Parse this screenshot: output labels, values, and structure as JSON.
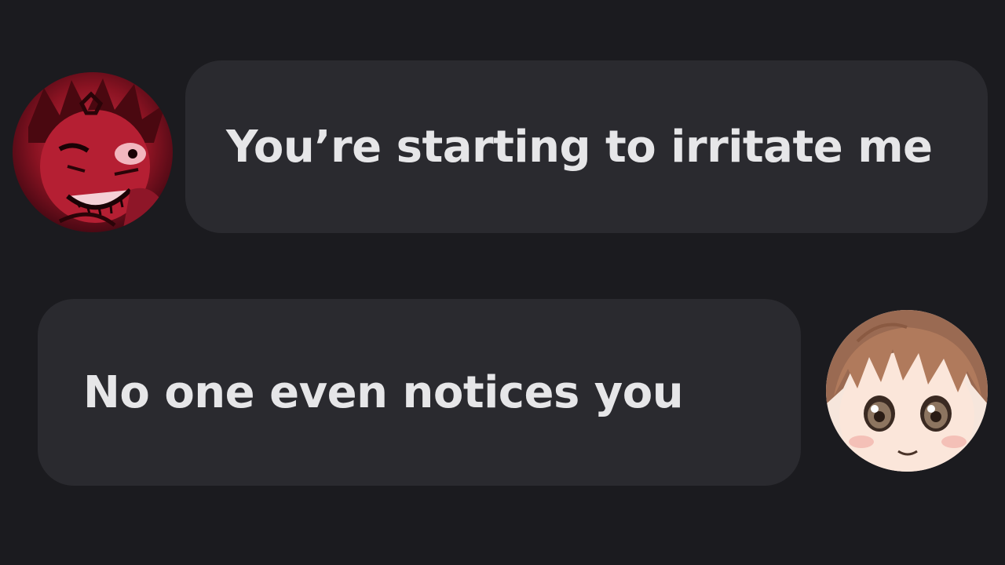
{
  "conversation": {
    "messages": [
      {
        "sender": "left",
        "avatar_icon": "red-demon-avatar-icon",
        "text": "You’re starting to irritate me"
      },
      {
        "sender": "right",
        "avatar_icon": "brown-hair-boy-avatar-icon",
        "text": "No one even notices you"
      }
    ]
  },
  "colors": {
    "background": "#1b1b1f",
    "bubble": "#2a2a2f",
    "text": "#e6e6e8"
  }
}
